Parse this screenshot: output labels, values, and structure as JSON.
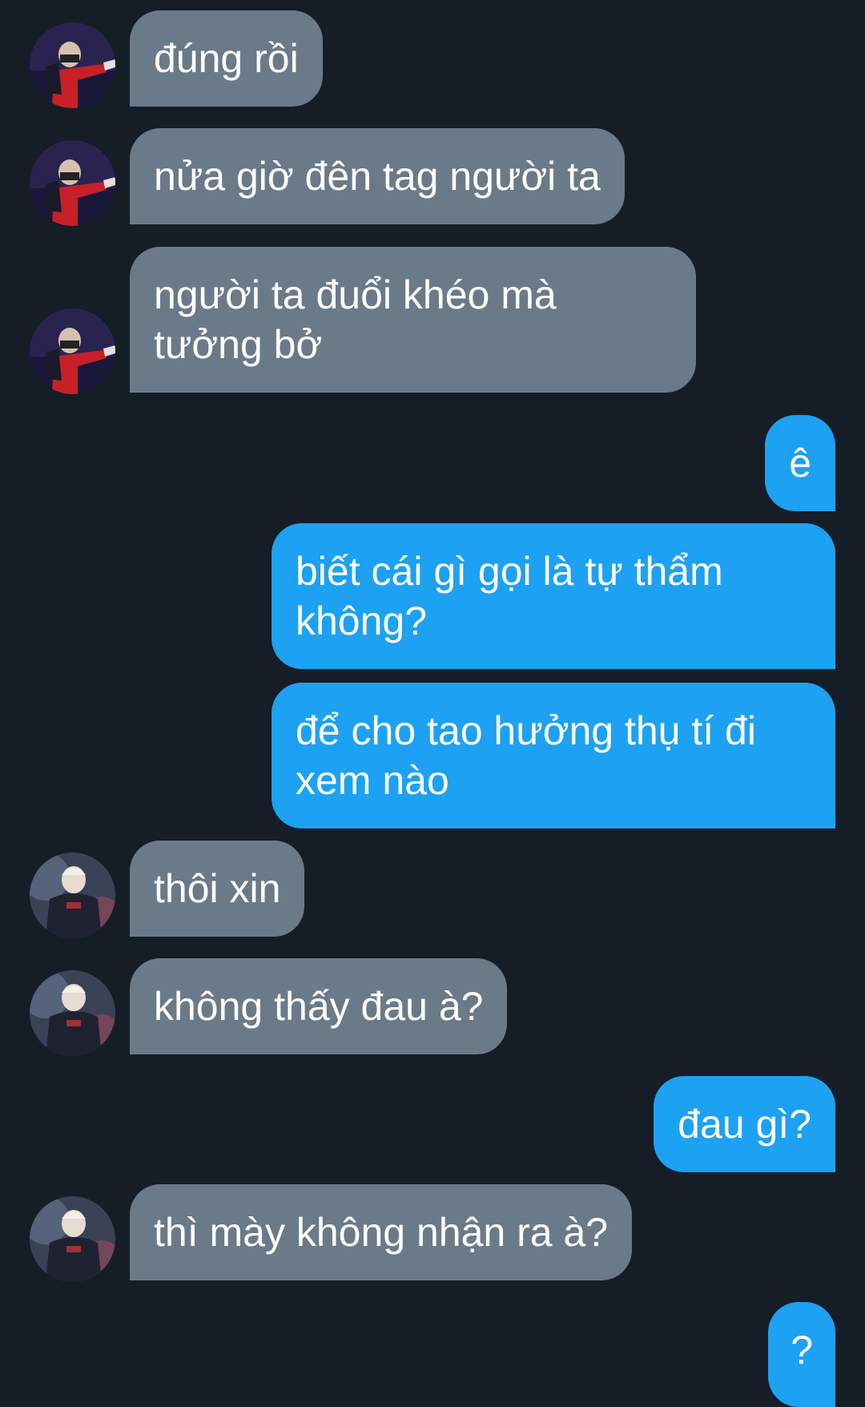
{
  "colors": {
    "background": "#151d27",
    "incoming_bubble": "#6b7a89",
    "outgoing_bubble": "#1da1f2",
    "text": "#ffffff"
  },
  "messages": [
    {
      "sender": "them",
      "avatar": "contact-a",
      "lines": [
        "đúng rồi"
      ]
    },
    {
      "sender": "them",
      "avatar": "contact-a",
      "lines": [
        "nửa giờ đên tag người ta"
      ]
    },
    {
      "sender": "them",
      "avatar": "contact-a",
      "lines": [
        "người ta đuổi khéo mà",
        "tưởng bở"
      ]
    },
    {
      "sender": "me",
      "lines": [
        "ê"
      ]
    },
    {
      "sender": "me",
      "lines": [
        "biết cái gì gọi là tự thẩm",
        "không?"
      ]
    },
    {
      "sender": "me",
      "lines": [
        "để cho tao hưởng thụ tí đi",
        "xem nào"
      ]
    },
    {
      "sender": "them",
      "avatar": "contact-b",
      "lines": [
        "thôi xin"
      ]
    },
    {
      "sender": "them",
      "avatar": "contact-b",
      "lines": [
        "không thấy đau à?"
      ]
    },
    {
      "sender": "me",
      "lines": [
        "đau gì?"
      ]
    },
    {
      "sender": "them",
      "avatar": "contact-b",
      "lines": [
        "thì mày không nhận ra à?"
      ]
    },
    {
      "sender": "me",
      "lines": [
        "?"
      ]
    }
  ]
}
